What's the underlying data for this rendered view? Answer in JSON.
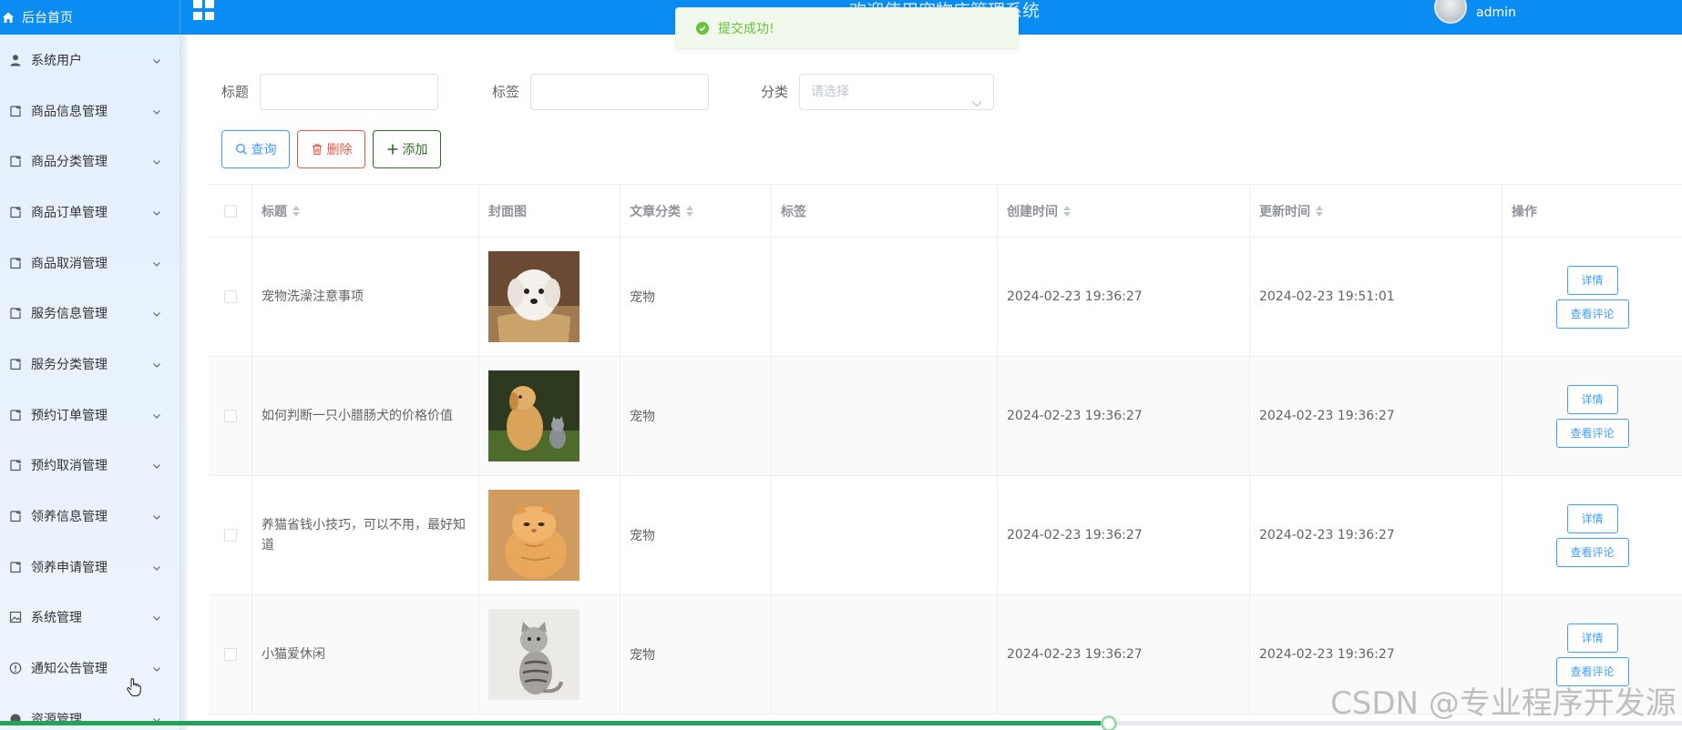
{
  "topbar": {
    "home_label": "后台首页",
    "system_title": "欢迎使用宠物店管理系统",
    "username": "admin",
    "accent_color": "#0a8cf2"
  },
  "toast": {
    "message": "提交成功!",
    "type": "success",
    "icon": "check-circle-icon"
  },
  "sidebar": {
    "items": [
      {
        "label": "系统用户",
        "icon": "user-icon"
      },
      {
        "label": "商品信息管理",
        "icon": "document-icon"
      },
      {
        "label": "商品分类管理",
        "icon": "document-icon"
      },
      {
        "label": "商品订单管理",
        "icon": "document-icon"
      },
      {
        "label": "商品取消管理",
        "icon": "document-icon"
      },
      {
        "label": "服务信息管理",
        "icon": "document-icon"
      },
      {
        "label": "服务分类管理",
        "icon": "document-icon"
      },
      {
        "label": "预约订单管理",
        "icon": "document-icon"
      },
      {
        "label": "预约取消管理",
        "icon": "document-icon"
      },
      {
        "label": "领养信息管理",
        "icon": "document-icon"
      },
      {
        "label": "领养申请管理",
        "icon": "document-icon"
      },
      {
        "label": "系统管理",
        "icon": "picture-icon"
      },
      {
        "label": "通知公告管理",
        "icon": "info-icon"
      },
      {
        "label": "资源管理",
        "icon": "resource-icon"
      }
    ]
  },
  "search": {
    "title_label": "标题",
    "title_value": "",
    "tag_label": "标签",
    "tag_value": "",
    "category_label": "分类",
    "category_placeholder": "请选择"
  },
  "actions": {
    "query": "查询",
    "delete": "删除",
    "add": "添加"
  },
  "table": {
    "headers": {
      "title": "标题",
      "cover": "封面图",
      "category": "文章分类",
      "tag": "标签",
      "created": "创建时间",
      "updated": "更新时间",
      "ops": "操作"
    },
    "op_detail": "详情",
    "op_comments": "查看评论",
    "rows": [
      {
        "title": "宠物洗澡注意事项",
        "category": "宠物",
        "tag": "",
        "created": "2024-02-23 19:36:27",
        "updated": "2024-02-23 19:51:01",
        "cover": "white-puppy"
      },
      {
        "title": "如何判断一只小腊肠犬的价格价值",
        "category": "宠物",
        "tag": "",
        "created": "2024-02-23 19:36:27",
        "updated": "2024-02-23 19:36:27",
        "cover": "puppy-and-kitten"
      },
      {
        "title": "养猫省钱小技巧，可以不用，最好知道",
        "category": "宠物",
        "tag": "",
        "created": "2024-02-23 19:36:27",
        "updated": "2024-02-23 19:36:27",
        "cover": "orange-cat"
      },
      {
        "title": "小猫爱休闲",
        "category": "宠物",
        "tag": "",
        "created": "2024-02-23 19:36:27",
        "updated": "2024-02-23 19:36:27",
        "cover": "tabby-cat"
      }
    ]
  },
  "progress": {
    "value": 0.659,
    "color": "#22a359"
  },
  "watermark": "CSDN @专业程序开发源"
}
